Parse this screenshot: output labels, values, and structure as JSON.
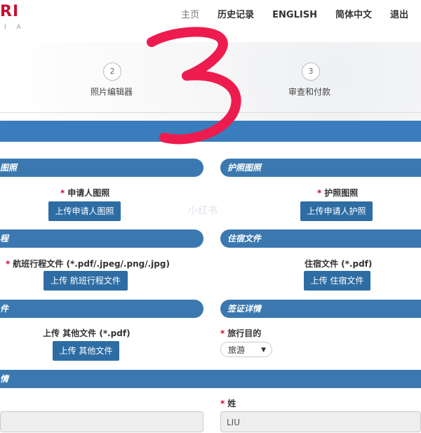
{
  "header": {
    "logo_text": "RI",
    "logo_sub": "I A",
    "nav": [
      "主页",
      "历史记录",
      "ENGLISH",
      "简体中文",
      "退出"
    ]
  },
  "steps": [
    {
      "number": "2",
      "label": "照片编辑器"
    },
    {
      "number": "3",
      "label": "审查和付款"
    }
  ],
  "overlay_digit": "3",
  "watermark": "小红书",
  "sections": {
    "applicant_photo": {
      "title": "图照",
      "label": "申请人图照",
      "button": "上传申请人图照"
    },
    "passport_photo": {
      "title": "护照图照",
      "label": "护照图照",
      "button": "上传申请人护照"
    },
    "flight": {
      "title": "程",
      "label": "航班行程文件 (*.pdf/.jpeg/.png/.jpg)",
      "button": "上传 航班行程文件"
    },
    "accommodation": {
      "title": "住宿文件",
      "label": "住宿文件 (*.pdf)",
      "button": "上传 住宿文件"
    },
    "other": {
      "title": "件",
      "label": "上传 其他文件 (*.pdf)",
      "button": "上传 其他文件"
    },
    "visa": {
      "title": "签证详情",
      "purpose_label": "旅行目的",
      "purpose_value": "旅游"
    },
    "personal": {
      "title": "情",
      "surname_label": "姓",
      "surname_value": "LIU"
    }
  },
  "required_mark": "*",
  "colors": {
    "primary": "#3a7dbd",
    "button": "#2e6da4",
    "required": "#c4122f",
    "overlay": "#ee1c4e"
  }
}
